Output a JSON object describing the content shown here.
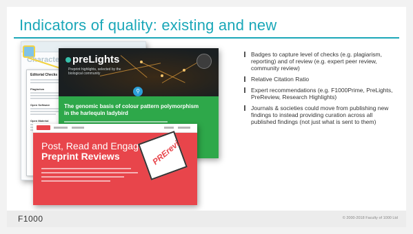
{
  "slide": {
    "title": "Indicators of quality: existing and new",
    "bullets": [
      "Badges to capture level of checks (e.g. plagiarism, reporting) and of review (e.g. expert peer review, community review)",
      "Relative Citation Ratio",
      "Expert recommendations (e.g. F1000Prime, PreLights, PreReview, Research Highlights)",
      "Journals & societies could move from publishing new findings to instead providing curation across all published findings (not just what is sent to them)"
    ],
    "footer": {
      "brand": "F1000",
      "copyright": "© 2000-2018 Faculty of 1000 Ltd"
    }
  },
  "screenshots": {
    "editorial": {
      "heading": "Characterization of cellulose-degrading",
      "popup_title": "Editorial Checks",
      "sections": [
        "Plagiarism",
        "Open Software",
        "Open Material"
      ]
    },
    "prelights": {
      "logo": "preLights",
      "tagline": "Preprint highlights, selected by the biological community",
      "article_title": "The genomic basis of colour pattern polymorphism in the harlequin ladybird"
    },
    "prereview": {
      "headline_line1": "Post, Read and Engage with",
      "headline_line2": "Preprint Reviews",
      "logo_text": "PREreview"
    }
  },
  "colors": {
    "accent": "#1aa7b8",
    "prelights_green": "#2ea84a",
    "prereview_red": "#e8454b"
  }
}
